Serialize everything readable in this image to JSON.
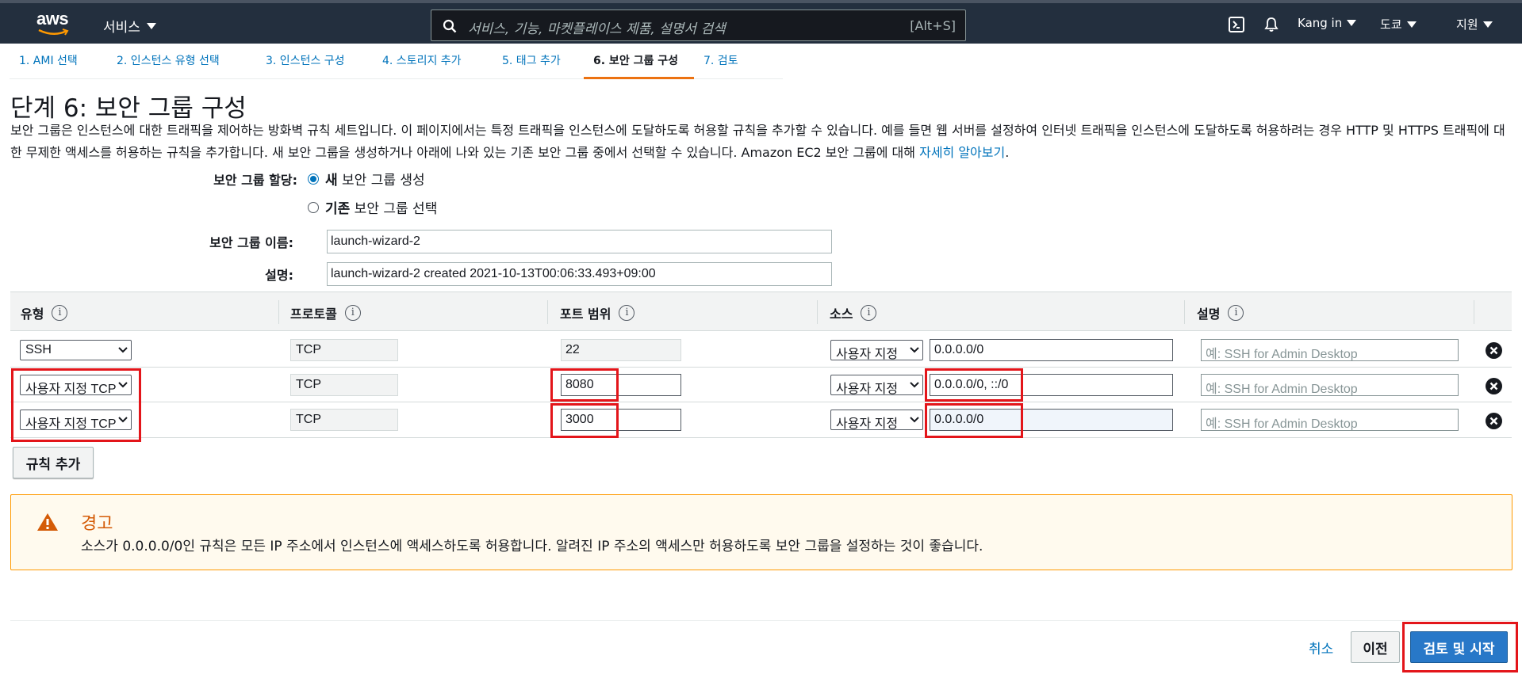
{
  "nav": {
    "logo_text": "aws",
    "services_label": "서비스",
    "search_placeholder": "서비스, 기능, 마켓플레이스 제품, 설명서 검색",
    "search_shortcut": "[Alt+S]",
    "user_label": "Kang in",
    "region_label": "도쿄",
    "support_label": "지원"
  },
  "wizard": {
    "tabs": [
      {
        "label": "1. AMI 선택"
      },
      {
        "label": "2. 인스턴스 유형 선택"
      },
      {
        "label": "3. 인스턴스 구성"
      },
      {
        "label": "4. 스토리지 추가"
      },
      {
        "label": "5. 태그 추가"
      },
      {
        "label": "6. 보안 그룹 구성"
      },
      {
        "label": "7. 검토"
      }
    ],
    "active_tab": 6
  },
  "page": {
    "title": "단계 6: 보안 그룹 구성",
    "intro": "보안 그룹은 인스턴스에 대한 트래픽을 제어하는 방화벽 규칙 세트입니다. 이 페이지에서는 특정 트래픽을 인스턴스에 도달하도록 허용할 규칙을 추가할 수 있습니다. 예를 들면 웹 서버를 설정하여 인터넷 트래픽을 인스턴스에 도달하도록 허용하려는 경우 HTTP 및 HTTPS 트래픽에 대한 무제한 액세스를 허용하는 규칙을 추가합니다. 새 보안 그룹을 생성하거나 아래에 나와 있는 기존 보안 그룹 중에서 선택할 수 있습니다. Amazon EC2 보안 그룹에 대해 ",
    "learn_more": "자세히 알아보기",
    "intro_end": "."
  },
  "form": {
    "assign_label": "보안 그룹 할당:",
    "radio_new_bold": "새",
    "radio_new_rest": " 보안 그룹 생성",
    "radio_existing_bold": "기존",
    "radio_existing_rest": " 보안 그룹 선택",
    "selected_option": "new",
    "name_label": "보안 그룹 이름:",
    "name_value": "launch-wizard-2",
    "desc_label": "설명:",
    "desc_value": "launch-wizard-2 created 2021-10-13T00:06:33.493+09:00"
  },
  "table": {
    "headers": [
      "유형",
      "프로토콜",
      "포트 범위",
      "소스",
      "설명"
    ],
    "info_glyph": "i",
    "rows": [
      {
        "type": "SSH",
        "protocol": "TCP",
        "port": "22",
        "source_type": "사용자 지정",
        "source": "0.0.0.0/0",
        "desc_placeholder": "예: SSH for Admin Desktop"
      },
      {
        "type": "사용자 지정 TCP",
        "protocol": "TCP",
        "port": "8080",
        "source_type": "사용자 지정",
        "source": "0.0.0.0/0, ::/0",
        "desc_placeholder": "예: SSH for Admin Desktop"
      },
      {
        "type": "사용자 지정 TCP",
        "protocol": "TCP",
        "port": "3000",
        "source_type": "사용자 지정",
        "source": "0.0.0.0/0",
        "desc_placeholder": "예: SSH for Admin Desktop"
      }
    ],
    "add_rule_label": "규칙 추가"
  },
  "warning": {
    "title": "경고",
    "text": "소스가 0.0.0.0/0인 규칙은 모든 IP 주소에서 인스턴스에 액세스하도록 허용합니다. 알려진 IP 주소의 액세스만 허용하도록 보안 그룹을 설정하는 것이 좋습니다."
  },
  "footer": {
    "cancel_label": "취소",
    "prev_label": "이전",
    "launch_label": "검토 및 시작"
  },
  "colors": {
    "nav_bg": "#232f3e",
    "link": "#0073bb",
    "active_tab": "#ec7211",
    "highlight": "#e3151a",
    "primary_button": "#2878c8",
    "warning_border": "#ff9900"
  }
}
